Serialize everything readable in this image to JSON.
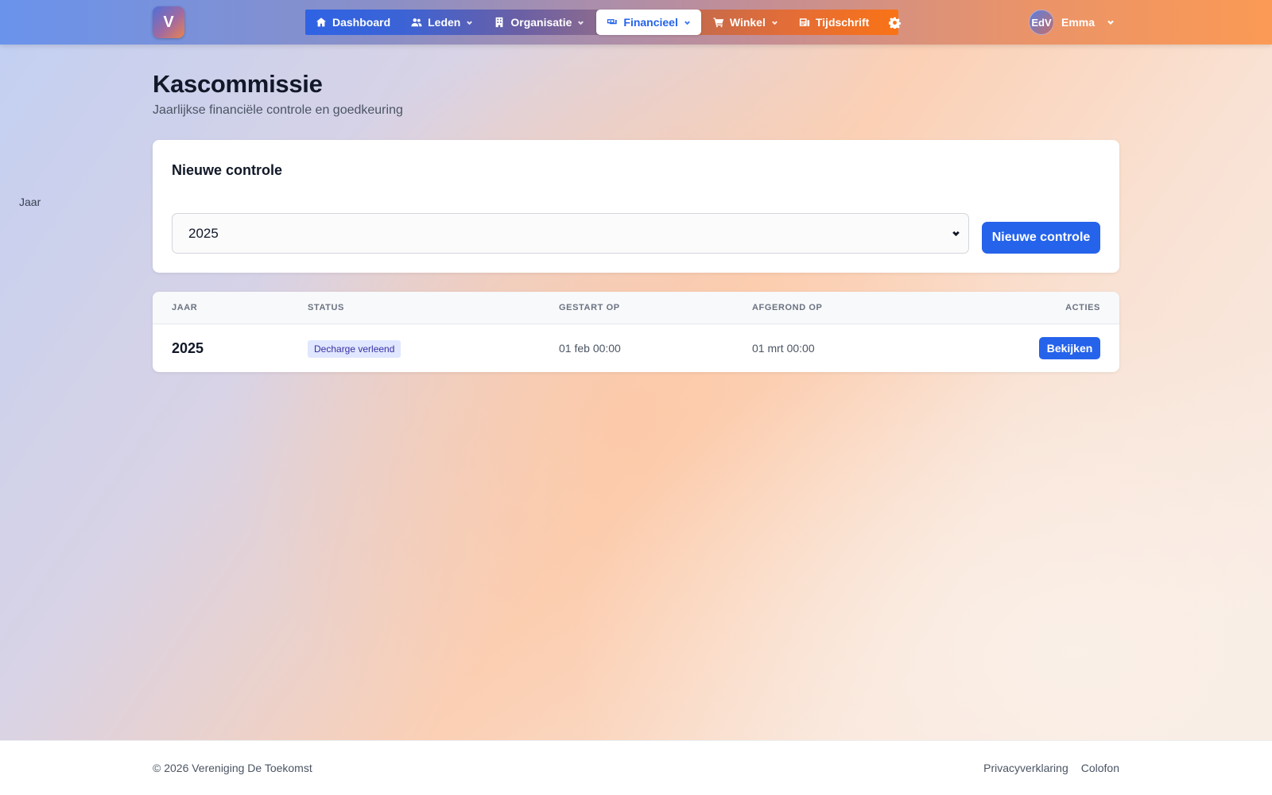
{
  "brand": {
    "logo_letter": "V"
  },
  "nav": {
    "items": [
      {
        "label": "Dashboard",
        "icon": "home-icon"
      },
      {
        "label": "Leden",
        "icon": "users-icon",
        "dropdown": true
      },
      {
        "label": "Organisatie",
        "icon": "building-icon",
        "dropdown": true
      },
      {
        "label": "Financieel",
        "icon": "money-icon",
        "dropdown": true,
        "active": true
      },
      {
        "label": "Winkel",
        "icon": "cart-icon",
        "dropdown": true
      },
      {
        "label": "Tijdschrift",
        "icon": "magazine-icon"
      }
    ],
    "settings_icon": "gear-icon"
  },
  "user": {
    "initials": "EdV",
    "name": "Emma"
  },
  "page": {
    "title": "Kascommissie",
    "subtitle": "Jaarlijkse financiële controle en goedkeuring"
  },
  "new_control": {
    "title": "Nieuwe controle",
    "year_label": "Jaar",
    "year_value": "2025",
    "submit_label": "Nieuwe controle"
  },
  "table": {
    "headers": [
      "JAAR",
      "STATUS",
      "GESTART OP",
      "AFGEROND OP",
      "ACTIES"
    ],
    "rows": [
      {
        "year": "2025",
        "status": "Decharge verleend",
        "started": "01 feb 00:00",
        "finished": "01 mrt 00:00",
        "action": "Bekijken"
      }
    ]
  },
  "footer": {
    "copyright": "© 2026 Vereniging De Toekomst",
    "links": [
      "Privacyverklaring",
      "Colofon"
    ]
  },
  "colors": {
    "primary": "#2563eb",
    "badge_bg": "#e0e7ff",
    "badge_text": "#3730a3"
  }
}
